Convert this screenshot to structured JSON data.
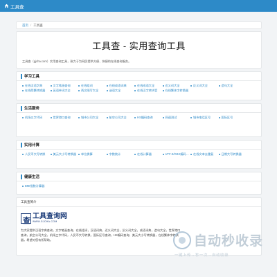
{
  "navbar": {
    "brand": "工具查"
  },
  "breadcrumb": {
    "home": "首页",
    "sep": "/",
    "current": "工具查"
  },
  "hero": {
    "title": "工具查 - 实用查询工具",
    "description": "工具查（gjcha.com）实用查询工具，致力于为网民提供方便、快捷的在线查询服务。"
  },
  "sections": [
    {
      "title": "学习工具",
      "links": [
        "在线汉语字典",
        "文字笔画查询",
        "在线组词",
        "在线成语词典",
        "在线成语大全",
        "近义词大全",
        "反义词大全",
        "造句大全",
        "在线简繁转换器",
        "英语单词大全",
        "两文随写大全",
        "谜语大全",
        "在线汉字转拼音",
        "在线繁体字转换器"
      ]
    },
    {
      "title": "生活服务",
      "links": [
        "机场三字代码",
        "世界港口查询",
        "城市公司大全",
        "航空公司大全",
        "HS编码查询",
        "网速测试",
        "城市电话区号",
        "国际区号"
      ]
    },
    {
      "title": "实用计算",
      "links": [
        "人民币大写转换",
        "美元大小写转换器",
        "单位换算",
        "字数统计",
        "在线计算器",
        "UTF-8/GBK编码…",
        "在线文本去重复",
        "日期大写转换器"
      ]
    },
    {
      "title": "健康生活",
      "links": [
        "BMI指数计算器"
      ]
    }
  ],
  "intro": {
    "head": "工具查简介",
    "logo_cn": "工具查询网",
    "logo_en": "WWW.GJCHA.COM",
    "logo_glyph": "查",
    "text": "为大家提供汉语字典查询，文字笔画查询，在线组词，汉语词典，近义词大全，反义词大全，成语词典，造句大全，世界港口查询，航空公司大全，机场三字代码，人民币大写转换，国际区号查询，HS编码查询，美元大小写转换器，在线繁体字转换器，希望对您有所帮助。"
  },
  "watermark": {
    "big": "自动秒收录",
    "small": "一键上传→秒一次→自动收录"
  },
  "colors": {
    "accent": "#2d8ac8",
    "navbar": "#2d8ac8",
    "background": "#f2f4f6"
  }
}
